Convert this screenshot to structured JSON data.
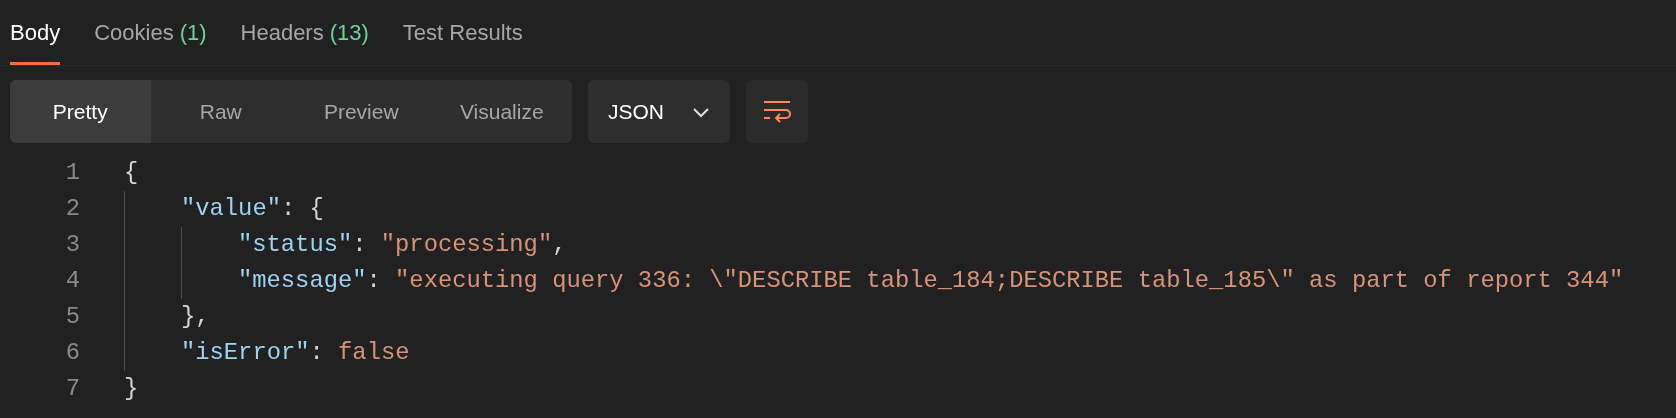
{
  "tabs": [
    {
      "label": "Body",
      "selected": true
    },
    {
      "label": "Cookies",
      "count": "(1)",
      "selected": false
    },
    {
      "label": "Headers",
      "count": "(13)",
      "selected": false
    },
    {
      "label": "Test Results",
      "selected": false
    }
  ],
  "toolbar": {
    "formats": [
      {
        "label": "Pretty",
        "selected": true
      },
      {
        "label": "Raw",
        "selected": false
      },
      {
        "label": "Preview",
        "selected": false
      },
      {
        "label": "Visualize",
        "selected": false
      }
    ],
    "language": "JSON",
    "wrap_lines": {
      "on": true
    }
  },
  "code": {
    "lines": [
      {
        "number": "1",
        "tokens": [
          {
            "kind": "punct",
            "text": "{"
          }
        ],
        "children": [
          {
            "number": "2",
            "tokens": [
              {
                "kind": "key",
                "text": "\"value\""
              },
              {
                "kind": "punct",
                "text": ": {"
              }
            ],
            "children": [
              {
                "number": "3",
                "tokens": [
                  {
                    "kind": "key",
                    "text": "\"status\""
                  },
                  {
                    "kind": "punct",
                    "text": ": "
                  },
                  {
                    "kind": "string",
                    "text": "\"processing\""
                  },
                  {
                    "kind": "punct",
                    "text": ","
                  }
                ]
              },
              {
                "number": "4",
                "tokens": [
                  {
                    "kind": "key",
                    "text": "\"message\""
                  },
                  {
                    "kind": "punct",
                    "text": ": "
                  },
                  {
                    "kind": "string",
                    "text": "\"executing query 336: \\\"DESCRIBE table_184;DESCRIBE table_185\\\" as part of report 344\""
                  }
                ]
              }
            ]
          },
          {
            "number": "5",
            "tokens": [
              {
                "kind": "punct",
                "text": "},"
              }
            ]
          },
          {
            "number": "6",
            "tokens": [
              {
                "kind": "key",
                "text": "\"isError\""
              },
              {
                "kind": "punct",
                "text": ": "
              },
              {
                "kind": "literal",
                "text": "false"
              }
            ]
          }
        ]
      },
      {
        "number": "7",
        "tokens": [
          {
            "kind": "punct",
            "text": "}"
          }
        ]
      }
    ]
  }
}
